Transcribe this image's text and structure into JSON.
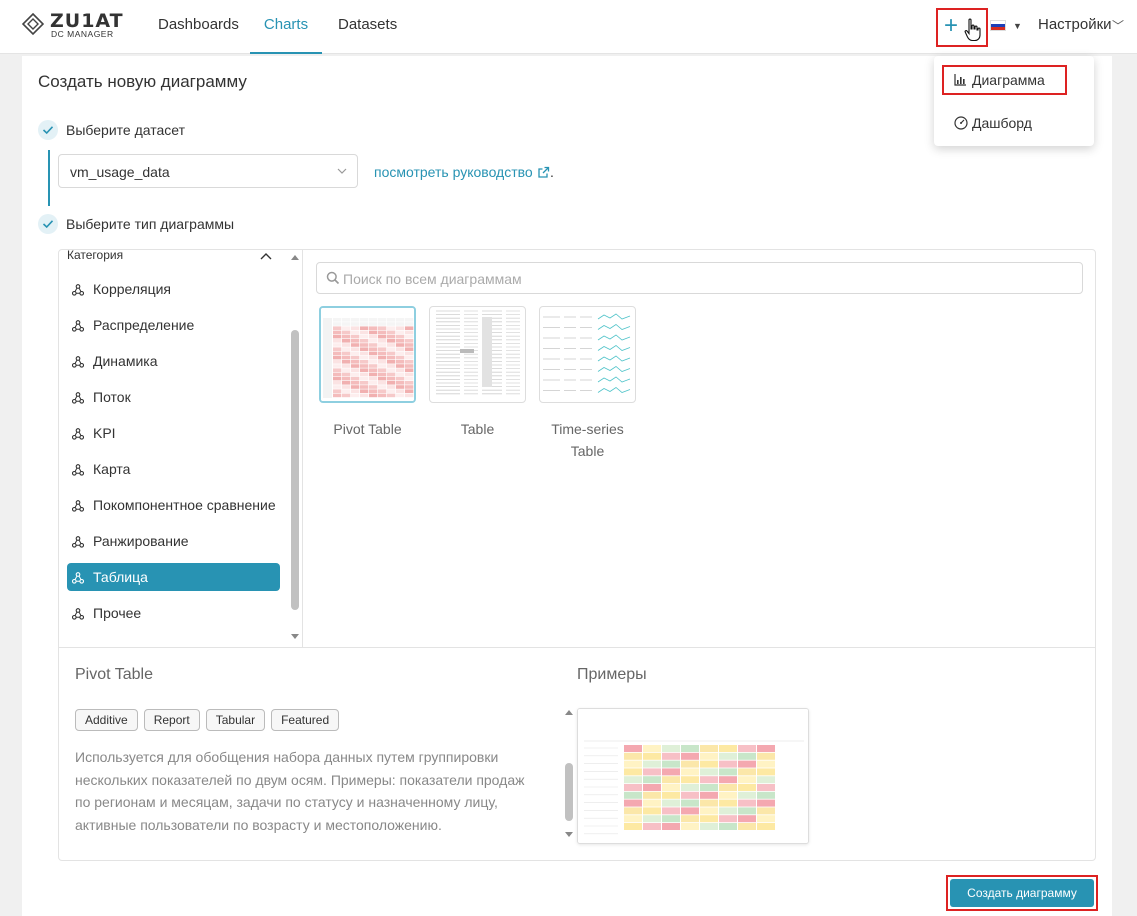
{
  "app": {
    "brand": "ZU1AT",
    "brand_sub": "DC MANAGER"
  },
  "nav": {
    "tabs": [
      {
        "label": "Dashboards",
        "active": false
      },
      {
        "label": "Charts",
        "active": true
      },
      {
        "label": "Datasets",
        "active": false
      }
    ],
    "add_label": "+",
    "language_flag": "ru-flag-icon",
    "settings_label": "Настройки"
  },
  "add_menu": {
    "items": [
      {
        "label": "Диаграмма",
        "icon": "bar-chart-icon",
        "highlighted": true
      },
      {
        "label": "Дашборд",
        "icon": "dashboard-gauge-icon",
        "highlighted": false
      }
    ]
  },
  "page": {
    "title": "Создать новую диаграмму",
    "step1_label": "Выберите датасет",
    "dataset_value": "vm_usage_data",
    "guide_link": "посмотреть руководство",
    "guide_suffix": ".",
    "step2_label": "Выберите тип диаграммы"
  },
  "categories": {
    "header": "Категория",
    "items": [
      {
        "label": "Корреляция",
        "active": false
      },
      {
        "label": "Распределение",
        "active": false
      },
      {
        "label": "Динамика",
        "active": false
      },
      {
        "label": "Поток",
        "active": false
      },
      {
        "label": "KPI",
        "active": false
      },
      {
        "label": "Карта",
        "active": false
      },
      {
        "label": "Покомпонентное сравнение",
        "active": false
      },
      {
        "label": "Ранжирование",
        "active": false
      },
      {
        "label": "Таблица",
        "active": true
      },
      {
        "label": "Прочее",
        "active": false
      }
    ]
  },
  "search": {
    "placeholder": "Поиск по всем диаграммам",
    "value": ""
  },
  "charts": [
    {
      "label": "Pivot Table",
      "selected": true
    },
    {
      "label": "Table",
      "selected": false
    },
    {
      "label": "Time-series Table",
      "selected": false
    }
  ],
  "details": {
    "title": "Pivot Table",
    "tags": [
      "Additive",
      "Report",
      "Tabular",
      "Featured"
    ],
    "description": "Используется для обобщения набора данных путем группировки нескольких показателей по двум осям. Примеры: показатели продаж по регионам и месяцам, задачи по статусу и назначенному лицу, активные пользователи по возрасту и местоположению.",
    "examples_title": "Примеры"
  },
  "footer": {
    "create_label": "Создать диаграмму"
  },
  "colors": {
    "accent": "#2893b3",
    "highlight_border": "#dd2222"
  }
}
